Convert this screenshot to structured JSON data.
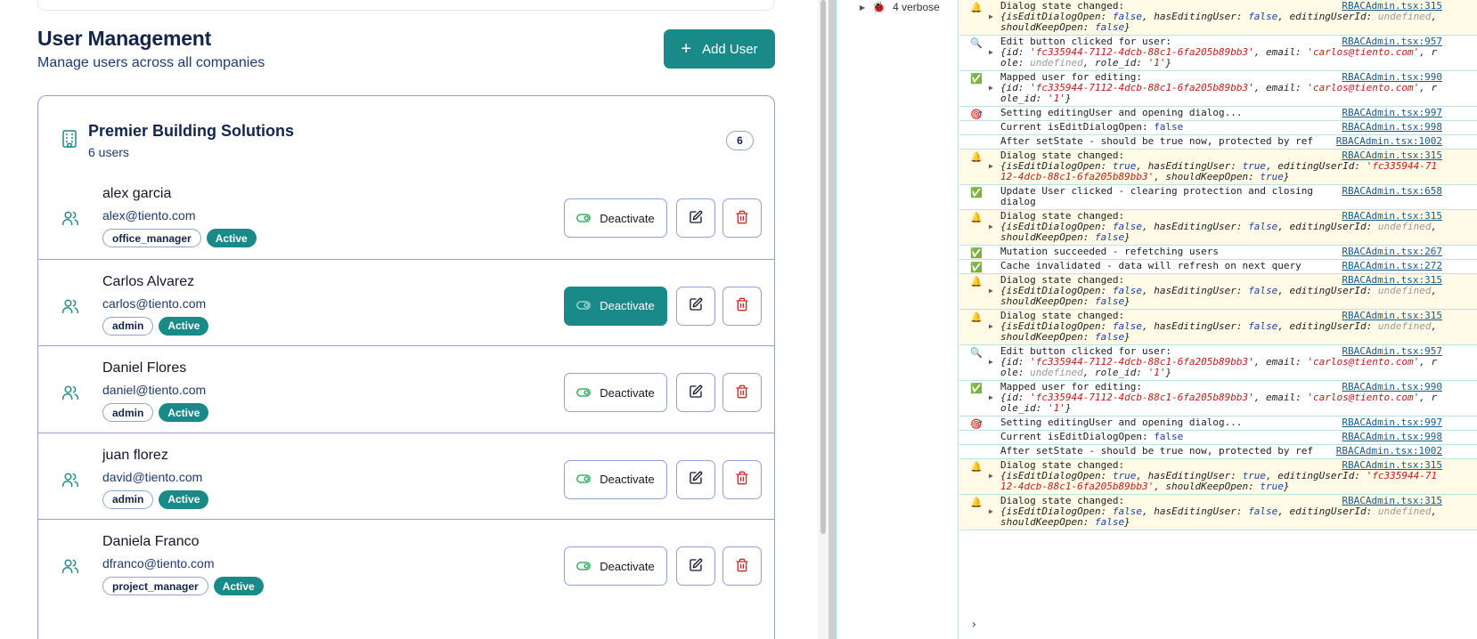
{
  "app": {
    "title": "User Management",
    "subtitle": "Manage users across all companies",
    "add_user_label": "Add User",
    "company": {
      "name": "Premier Building Solutions",
      "users_count_label": "6 users",
      "count_badge": "6"
    },
    "users": [
      {
        "name": "alex garcia",
        "email": "alex@tiento.com",
        "role": "office_manager",
        "status": "Active",
        "action_label": "Deactivate"
      },
      {
        "name": "Carlos Alvarez",
        "email": "carlos@tiento.com",
        "role": "admin",
        "status": "Active",
        "action_label": "Deactivate"
      },
      {
        "name": "Daniel Flores",
        "email": "daniel@tiento.com",
        "role": "admin",
        "status": "Active",
        "action_label": "Deactivate"
      },
      {
        "name": "juan florez",
        "email": "david@tiento.com",
        "role": "admin",
        "status": "Active",
        "action_label": "Deactivate"
      },
      {
        "name": "Daniela Franco",
        "email": "dfranco@tiento.com",
        "role": "project_manager",
        "status": "Active",
        "action_label": "Deactivate"
      }
    ],
    "colors": {
      "accent": "#1a8a88",
      "danger": "#dc2626",
      "border": "#8fa4cf"
    }
  },
  "devtools": {
    "sidebar_verbose": "4 verbose",
    "logs": [
      {
        "icon": "🔔",
        "msg": "Dialog state changed:",
        "src": "RBACAdmin.tsx:315",
        "obj": "{isEditDialogOpen: false, hasEditingUser: false, editingUserId: undefined, shouldKeepOpen: false}",
        "warn": true
      },
      {
        "icon": "🔍",
        "msg": "Edit button clicked for user:",
        "src": "RBACAdmin.tsx:957",
        "obj": "{id: 'fc335944-7112-4dcb-88c1-6fa205b89bb3', email: 'carlos@tiento.com', role: undefined, role_id: '1'}"
      },
      {
        "icon": "✅",
        "msg": "Mapped user for editing:",
        "src": "RBACAdmin.tsx:990",
        "obj": "{id: 'fc335944-7112-4dcb-88c1-6fa205b89bb3', email: 'carlos@tiento.com', role_id: '1'}"
      },
      {
        "icon": "🎯",
        "msg": "Setting editingUser and opening dialog...",
        "src": "RBACAdmin.tsx:997"
      },
      {
        "icon": "",
        "msg": "Current isEditDialogOpen: false",
        "src": "RBACAdmin.tsx:998"
      },
      {
        "icon": "",
        "msg": "After setState - should be true now, protected by ref",
        "src": "RBACAdmin.tsx:1002"
      },
      {
        "icon": "🔔",
        "msg": "Dialog state changed:",
        "src": "RBACAdmin.tsx:315",
        "obj": "{isEditDialogOpen: true, hasEditingUser: true, editingUserId: 'fc335944-7112-4dcb-88c1-6fa205b89bb3', shouldKeepOpen: true}",
        "warn": true
      },
      {
        "icon": "✅",
        "msg": "Update User clicked - clearing protection and closing dialog",
        "src": "RBACAdmin.tsx:658"
      },
      {
        "icon": "🔔",
        "msg": "Dialog state changed:",
        "src": "RBACAdmin.tsx:315",
        "obj": "{isEditDialogOpen: false, hasEditingUser: false, editingUserId: undefined, shouldKeepOpen: false}",
        "warn": true
      },
      {
        "icon": "✅",
        "msg": "Mutation succeeded - refetching users",
        "src": "RBACAdmin.tsx:267"
      },
      {
        "icon": "✅",
        "msg": "Cache invalidated - data will refresh on next query",
        "src": "RBACAdmin.tsx:272"
      },
      {
        "icon": "🔔",
        "msg": "Dialog state changed:",
        "src": "RBACAdmin.tsx:315",
        "obj": "{isEditDialogOpen: false, hasEditingUser: false, editingUserId: undefined, shouldKeepOpen: false}",
        "warn": true
      },
      {
        "icon": "🔔",
        "msg": "Dialog state changed:",
        "src": "RBACAdmin.tsx:315",
        "obj": "{isEditDialogOpen: false, hasEditingUser: false, editingUserId: undefined, shouldKeepOpen: false}",
        "warn": true
      },
      {
        "icon": "🔍",
        "msg": "Edit button clicked for user:",
        "src": "RBACAdmin.tsx:957",
        "obj": "{id: 'fc335944-7112-4dcb-88c1-6fa205b89bb3', email: 'carlos@tiento.com', role: undefined, role_id: '1'}"
      },
      {
        "icon": "✅",
        "msg": "Mapped user for editing:",
        "src": "RBACAdmin.tsx:990",
        "obj": "{id: 'fc335944-7112-4dcb-88c1-6fa205b89bb3', email: 'carlos@tiento.com', role_id: '1'}"
      },
      {
        "icon": "🎯",
        "msg": "Setting editingUser and opening dialog...",
        "src": "RBACAdmin.tsx:997"
      },
      {
        "icon": "",
        "msg": "Current isEditDialogOpen: false",
        "src": "RBACAdmin.tsx:998"
      },
      {
        "icon": "",
        "msg": "After setState - should be true now, protected by ref",
        "src": "RBACAdmin.tsx:1002"
      },
      {
        "icon": "🔔",
        "msg": "Dialog state changed:",
        "src": "RBACAdmin.tsx:315",
        "obj": "{isEditDialogOpen: true, hasEditingUser: true, editingUserId: 'fc335944-7112-4dcb-88c1-6fa205b89bb3', shouldKeepOpen: true}",
        "warn": true
      },
      {
        "icon": "🔔",
        "msg": "Dialog state changed:",
        "src": "RBACAdmin.tsx:315",
        "obj": "{isEditDialogOpen: false, hasEditingUser: false, editingUserId: undefined, shouldKeepOpen: false}",
        "warn": true
      }
    ],
    "prompt_caret": "›"
  }
}
